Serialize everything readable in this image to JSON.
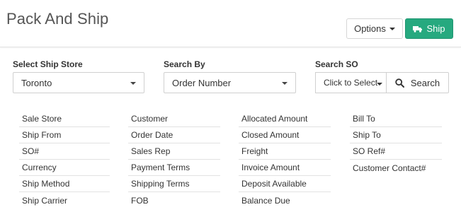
{
  "header": {
    "title": "Pack And Ship",
    "options_label": "Options",
    "ship_label": "Ship",
    "ship_color": "#26a97f"
  },
  "form": {
    "ship_store": {
      "label": "Select Ship Store",
      "value": "Toronto"
    },
    "search_by": {
      "label": "Search By",
      "value": "Order Number"
    },
    "search_so": {
      "label": "Search SO",
      "placeholder": "Click to Select",
      "button_label": "Search"
    }
  },
  "fields": {
    "col1": [
      "Sale Store",
      "Ship From",
      "SO#",
      "Currency",
      "Ship Method",
      "Ship Carrier"
    ],
    "col2": [
      "Customer",
      "Order Date",
      "Sales Rep",
      "Payment Terms",
      "Shipping Terms",
      "FOB"
    ],
    "col3": [
      "Allocated Amount",
      "Closed Amount",
      "Freight",
      "Invoice Amount",
      "Deposit Available",
      "Balance Due"
    ],
    "col4": [
      "Bill To",
      "Ship To",
      "SO Ref#",
      "Customer Contact#"
    ]
  },
  "icons": {
    "ship": "truck-icon",
    "search": "search-icon",
    "dropdown": "chevron-down-icon"
  }
}
